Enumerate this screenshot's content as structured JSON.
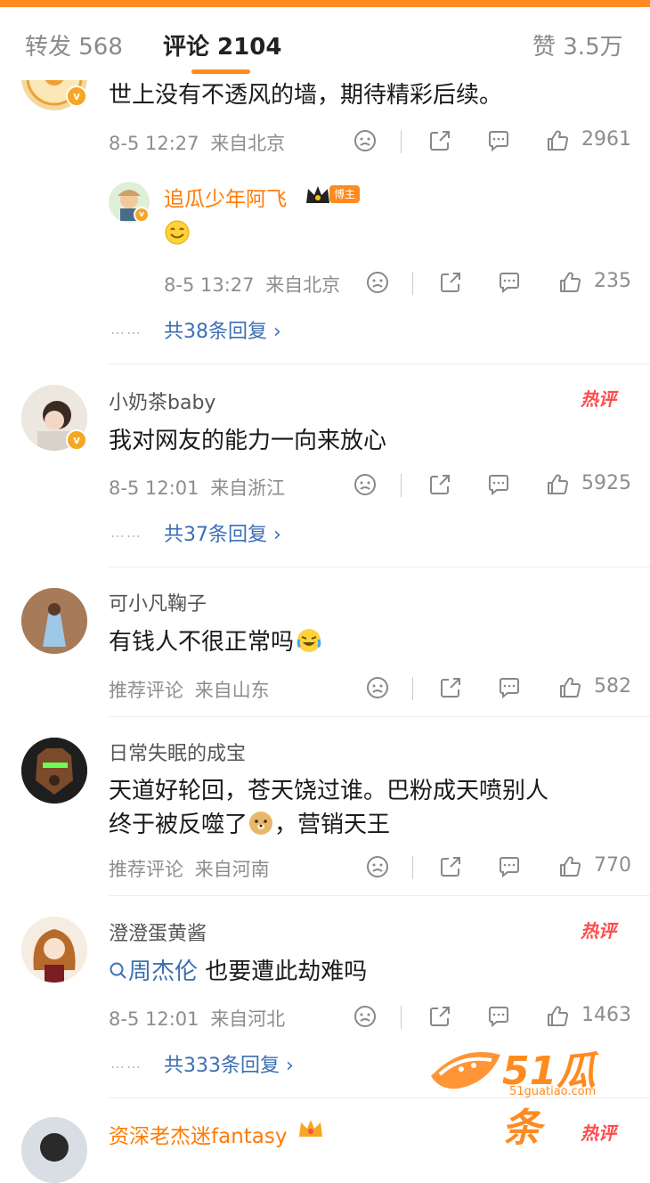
{
  "tabs": {
    "repost_label": "转发 568",
    "comments_label": "评论 2104",
    "likes_label": "赞 3.5万"
  },
  "comments": [
    {
      "text": "世上没有不透风的墙，期待精彩后续。",
      "date": "8-5 12:27",
      "location": "来自北京",
      "likes": "2961",
      "reply": {
        "username": "追瓜少年阿飞",
        "badge": "博主",
        "date": "8-5 13:27",
        "location": "来自北京",
        "likes": "235"
      },
      "more_replies": "共38条回复",
      "dots": "……"
    },
    {
      "username": "小奶茶baby",
      "text": "我对网友的能力一向来放心",
      "date": "8-5 12:01",
      "location": "来自浙江",
      "likes": "5925",
      "hot": "热评",
      "more_replies": "共37条回复",
      "dots": "……"
    },
    {
      "username": "可小凡鞠子",
      "text": "有钱人不很正常吗",
      "date": "推荐评论",
      "location": "来自山东",
      "likes": "582"
    },
    {
      "username": "日常失眠的成宝",
      "text_line1": "天道好轮回，苍天饶过谁。巴粉成天喷别人",
      "text_line2a": "终于被反噬了",
      "text_line2b": "，营销天王",
      "date": "推荐评论",
      "location": "来自河南",
      "likes": "770"
    },
    {
      "username": "澄澄蛋黄酱",
      "topic": "周杰伦",
      "text_rest": " 也要遭此劫难吗",
      "date": "8-5 12:01",
      "location": "来自河北",
      "likes": "1463",
      "hot": "热评",
      "more_replies": "共333条回复",
      "dots": "……"
    },
    {
      "username": "资深老杰迷fantasy",
      "hot": "热评"
    }
  ],
  "watermark": {
    "brand": "51瓜条",
    "url": "51guatiao.com"
  },
  "colors": {
    "accent": "#ff8a1f",
    "link": "#3b6fb3",
    "hot": "#ff4b4b",
    "username_highlight": "#ff7a00"
  }
}
